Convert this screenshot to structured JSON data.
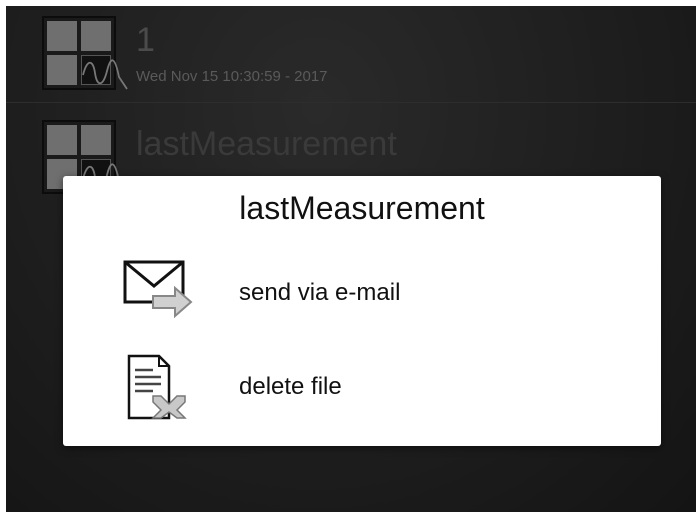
{
  "files": [
    {
      "name": "1",
      "date": "Wed Nov 15 10:30:59 - 2017",
      "icon": "measurement-thumbnail-icon"
    },
    {
      "name": "lastMeasurement",
      "icon": "measurement-thumbnail-icon"
    }
  ],
  "dialog": {
    "title": "lastMeasurement",
    "options": [
      {
        "label": "send via e-mail",
        "icon": "email-send-icon"
      },
      {
        "label": "delete file",
        "icon": "delete-file-icon"
      }
    ]
  }
}
